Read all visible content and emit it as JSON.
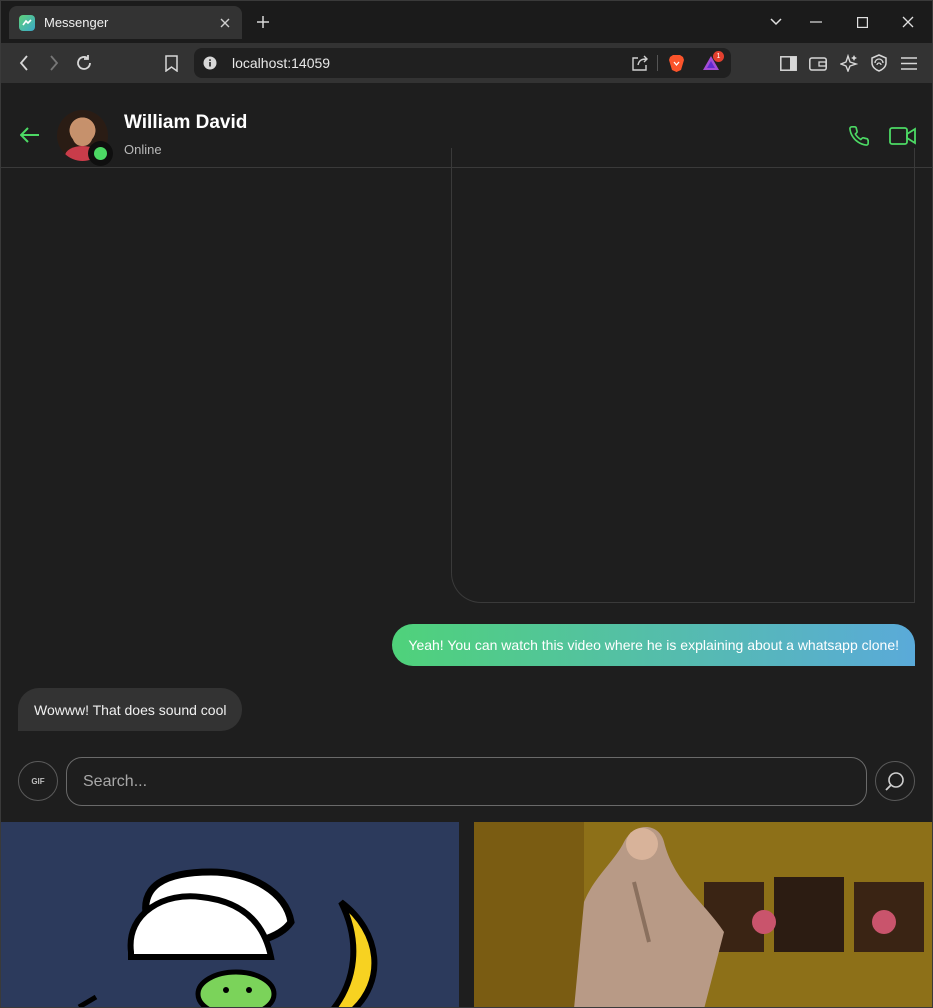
{
  "browser": {
    "tab_title": "Messenger",
    "url": "localhost:14059",
    "notification_count": "1"
  },
  "header": {
    "contact_name": "William David",
    "status": "Online"
  },
  "messages": {
    "outgoing": "Yeah! You can watch this video where he is explaining about a whatsapp clone!",
    "incoming": "Wowww! That does sound cool"
  },
  "gif_search": {
    "gif_label": "GIF",
    "placeholder": "Search..."
  },
  "colors": {
    "accent": "#4cd964",
    "bubble_gradient_start": "#4fd27a",
    "bubble_gradient_end": "#5aaad9"
  }
}
